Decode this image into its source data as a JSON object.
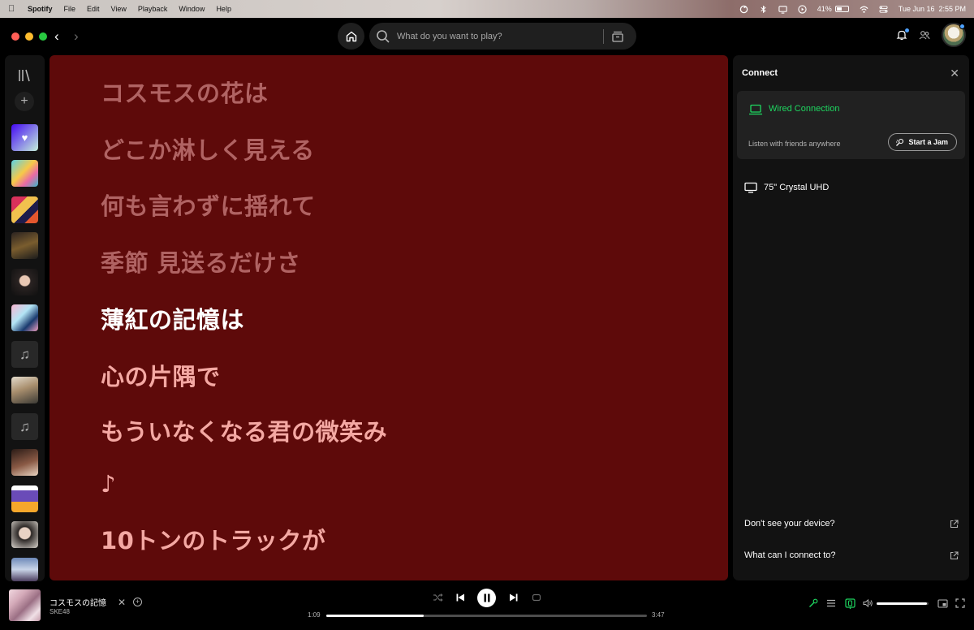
{
  "menubar": {
    "app_name": "Spotify",
    "menus": [
      "File",
      "Edit",
      "View",
      "Playback",
      "Window",
      "Help"
    ],
    "battery": "41%",
    "datetime": "Tue Jun 16  2:55 PM"
  },
  "topbar": {
    "search_placeholder": "What do you want to play?"
  },
  "lyrics": [
    {
      "text": "コスモスの花は",
      "state": "past"
    },
    {
      "text": "どこか淋しく見える",
      "state": "past"
    },
    {
      "text": "何も言わずに揺れて",
      "state": "past"
    },
    {
      "text": "季節 見送るだけさ",
      "state": "past"
    },
    {
      "text": "薄紅の記憶は",
      "state": "current"
    },
    {
      "text": "心の片隅で",
      "state": "future"
    },
    {
      "text": "もういなくなる君の微笑み",
      "state": "future"
    },
    {
      "text": "♪",
      "state": "future"
    },
    {
      "text": "10トンのトラックが",
      "state": "future"
    }
  ],
  "connect": {
    "title": "Connect",
    "current_device": "Wired Connection",
    "jam_text": "Listen with friends anywhere",
    "jam_button": "Start a Jam",
    "other_device": "75\" Crystal UHD",
    "help_1": "Don't see your device?",
    "help_2": "What can I connect to?"
  },
  "player": {
    "title": "コスモスの記憶",
    "artist": "SKE48",
    "elapsed": "1:09",
    "duration": "3:47",
    "progress_fraction": 0.305,
    "volume_fraction": 0.97
  },
  "colors": {
    "lyrics_bg": "#5e0a0a",
    "accent_green": "#1ed760",
    "past_line": "#b06363",
    "future_line": "#f4a8a3"
  }
}
